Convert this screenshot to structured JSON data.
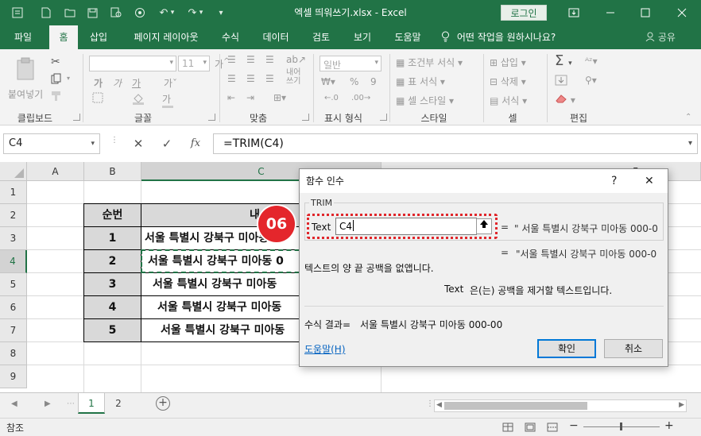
{
  "titlebar": {
    "title": "엑셀 띄워쓰기.xlsx  -  Excel",
    "login": "로그인",
    "quick_access_icons": [
      "autosave-icon",
      "new-file-icon",
      "open-icon",
      "save-icon",
      "print-preview-icon",
      "undo-icon",
      "redo-icon",
      "customize-icon"
    ],
    "window_buttons": [
      "ribbon-display-icon",
      "minimize-icon",
      "maximize-icon",
      "close-icon"
    ]
  },
  "tabs": [
    "파일",
    "홈",
    "삽입",
    "페이지 레이아웃",
    "수식",
    "데이터",
    "검토",
    "보기",
    "도움말"
  ],
  "active_tab": "홈",
  "tell_me": "어떤 작업을 원하시나요?",
  "share": "공유",
  "ribbon": {
    "clipboard": {
      "label": "클립보드",
      "paste": "붙여넣기"
    },
    "font": {
      "label": "글꼴",
      "size": "11",
      "bold": "가",
      "italic": "가",
      "underline": "가"
    },
    "alignment": {
      "label": "맞춤",
      "wrap": "내어",
      "wrap2": "쓰기"
    },
    "number": {
      "label": "표시 형식",
      "format": "일반",
      "percent": "%",
      "comma": "9"
    },
    "styles": {
      "label": "스타일",
      "conditional": "조건부 서식",
      "table": "표 서식",
      "cell": "셀 스타일"
    },
    "cells": {
      "label": "셀",
      "insert": "삽입",
      "delete": "삭제",
      "format": "서식"
    },
    "editing": {
      "label": "편집"
    }
  },
  "formula_bar": {
    "name_box": "C4",
    "cancel": "✕",
    "enter": "✓",
    "fx": "fx",
    "formula": "=TRIM(C4)"
  },
  "grid": {
    "columns": [
      "A",
      "B",
      "C",
      "F"
    ],
    "rows": [
      "1",
      "2",
      "3",
      "4",
      "5",
      "6",
      "7",
      "8",
      "9"
    ],
    "active_row": "4",
    "table_header": [
      "순번",
      "내"
    ],
    "table_rows": [
      {
        "num": "1",
        "addr": "서울 특별시 강북구 미아동 00"
      },
      {
        "num": "2",
        "addr": "서울 특별시 강북구 미아동 0"
      },
      {
        "num": "3",
        "addr": "서울 특별시 강북구 미아동"
      },
      {
        "num": "4",
        "addr": "서울 특별시 강북구 미아동"
      },
      {
        "num": "5",
        "addr": "서울 특별시 강북구 미아동"
      }
    ]
  },
  "sheets": [
    "1",
    "2"
  ],
  "active_sheet": "1",
  "status": {
    "mode": "참조"
  },
  "dialog": {
    "title": "함수 인수",
    "help_btn": "?",
    "close_btn": "✕",
    "function_name": "TRIM",
    "arg_label": "Text",
    "arg_value": "C4",
    "arg_equals": "=",
    "arg_result": "\" 서울 특별시 강북구 미아동 000-0",
    "result_equals": "=",
    "result_preview": "\"서울 특별시 강북구 미아동 000-0",
    "description": "텍스트의 양 끝 공백을 없앱니다.",
    "arg_description_name": "Text",
    "arg_description": "은(는) 공백을 제거할 텍스트입니다.",
    "formula_result_label": "수식 결과=",
    "formula_result": "서울 특별시 강북구 미아동 000-00",
    "help_link": "도움말(H)",
    "ok": "확인",
    "cancel": "취소"
  },
  "step_badge": "06",
  "colors": {
    "excel_green": "#217346",
    "badge_red": "#e4262c",
    "dialog_focus": "#0078d7"
  }
}
